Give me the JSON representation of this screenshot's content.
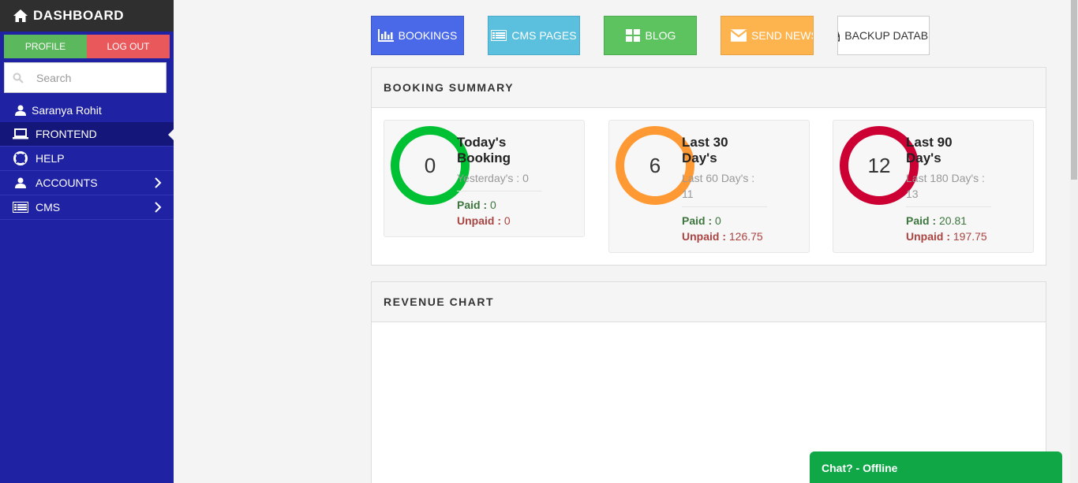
{
  "sidebar": {
    "brand": "DASHBOARD",
    "profile_label": "PROFILE",
    "logout_label": "LOG OUT",
    "search_placeholder": "Search",
    "user_name": "Saranya Rohit",
    "items": [
      {
        "label": "FRONTEND",
        "icon": "laptop-icon",
        "active": true
      },
      {
        "label": "HELP",
        "icon": "lifebuoy-icon"
      },
      {
        "label": "ACCOUNTS",
        "icon": "user-icon",
        "expandable": true
      },
      {
        "label": "CMS",
        "icon": "list-icon",
        "expandable": true
      }
    ]
  },
  "toolbar": {
    "bookings": "BOOKINGS",
    "cms_pages": "CMS PAGES",
    "blog": "BLOG",
    "send_newsletter": "SEND NEWSLETTER",
    "backup_database": "BACKUP DATABSE"
  },
  "booking_summary": {
    "title": "BOOKING SUMMARY",
    "paid_label": "Paid :",
    "unpaid_label": "Unpaid :",
    "cards": [
      {
        "count": "0",
        "title_line1": "Today's",
        "title_line2": "Booking",
        "sub": "Yesterday's : 0",
        "paid": "0",
        "unpaid": "0",
        "color": "#00c033"
      },
      {
        "count": "6",
        "title_line1": "Last 30",
        "title_line2": "Day's",
        "sub": "Last 60 Day's : 11",
        "paid": "0",
        "unpaid": "126.75",
        "color": "#ff9933"
      },
      {
        "count": "12",
        "title_line1": "Last 90",
        "title_line2": "Day's",
        "sub": "Last 180 Day's : 13",
        "paid": "20.81",
        "unpaid": "197.75",
        "color": "#cc0033"
      }
    ]
  },
  "revenue_chart": {
    "title": "REVENUE CHART"
  },
  "chat": {
    "label": "Chat? - Offline"
  },
  "colors": {
    "sidebar": "#1f22a2",
    "bookings": "#4a69e8",
    "cms": "#5bc0de",
    "blog": "#5cc35e",
    "newsletter": "#fdb44e",
    "chat": "#10a847"
  }
}
